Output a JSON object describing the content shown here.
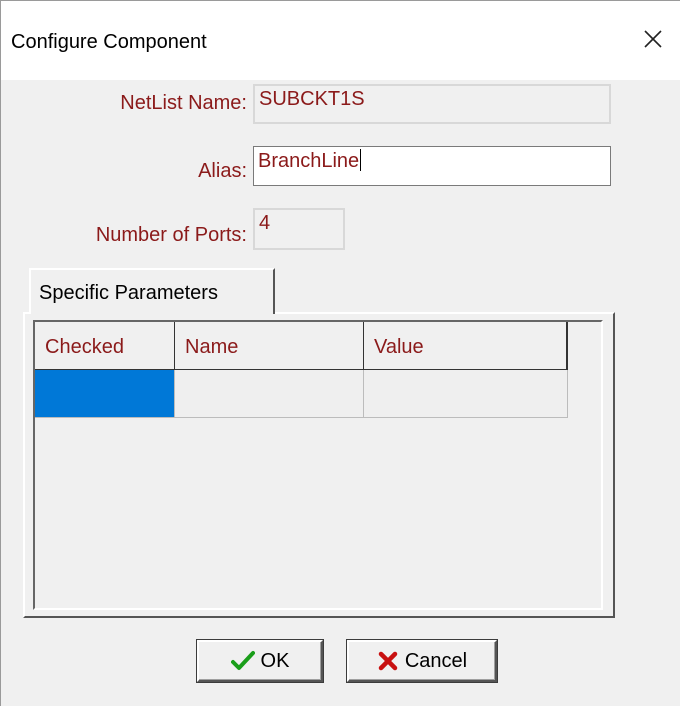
{
  "window": {
    "title": "Configure Component"
  },
  "fields": {
    "netlist_name": {
      "label": "NetList Name:",
      "value": "SUBCKT1S"
    },
    "alias": {
      "label": "Alias:",
      "value": "BranchLine"
    },
    "number_of_ports": {
      "label": "Number of Ports:",
      "value": "4"
    }
  },
  "tabs": [
    {
      "label": "Specific Parameters"
    }
  ],
  "table": {
    "columns": [
      "Checked",
      "Name",
      "Value"
    ],
    "rows": [
      [
        "",
        "",
        ""
      ]
    ]
  },
  "buttons": {
    "ok_label": "OK",
    "cancel_label": "Cancel"
  },
  "colors": {
    "label": "#8b1a1a",
    "selection": "#0078d7",
    "ok_check": "#1a9e1a",
    "cancel_x": "#c81010"
  },
  "icons": {
    "close": "close-icon",
    "ok": "checkmark-icon",
    "cancel": "x-mark-icon"
  }
}
